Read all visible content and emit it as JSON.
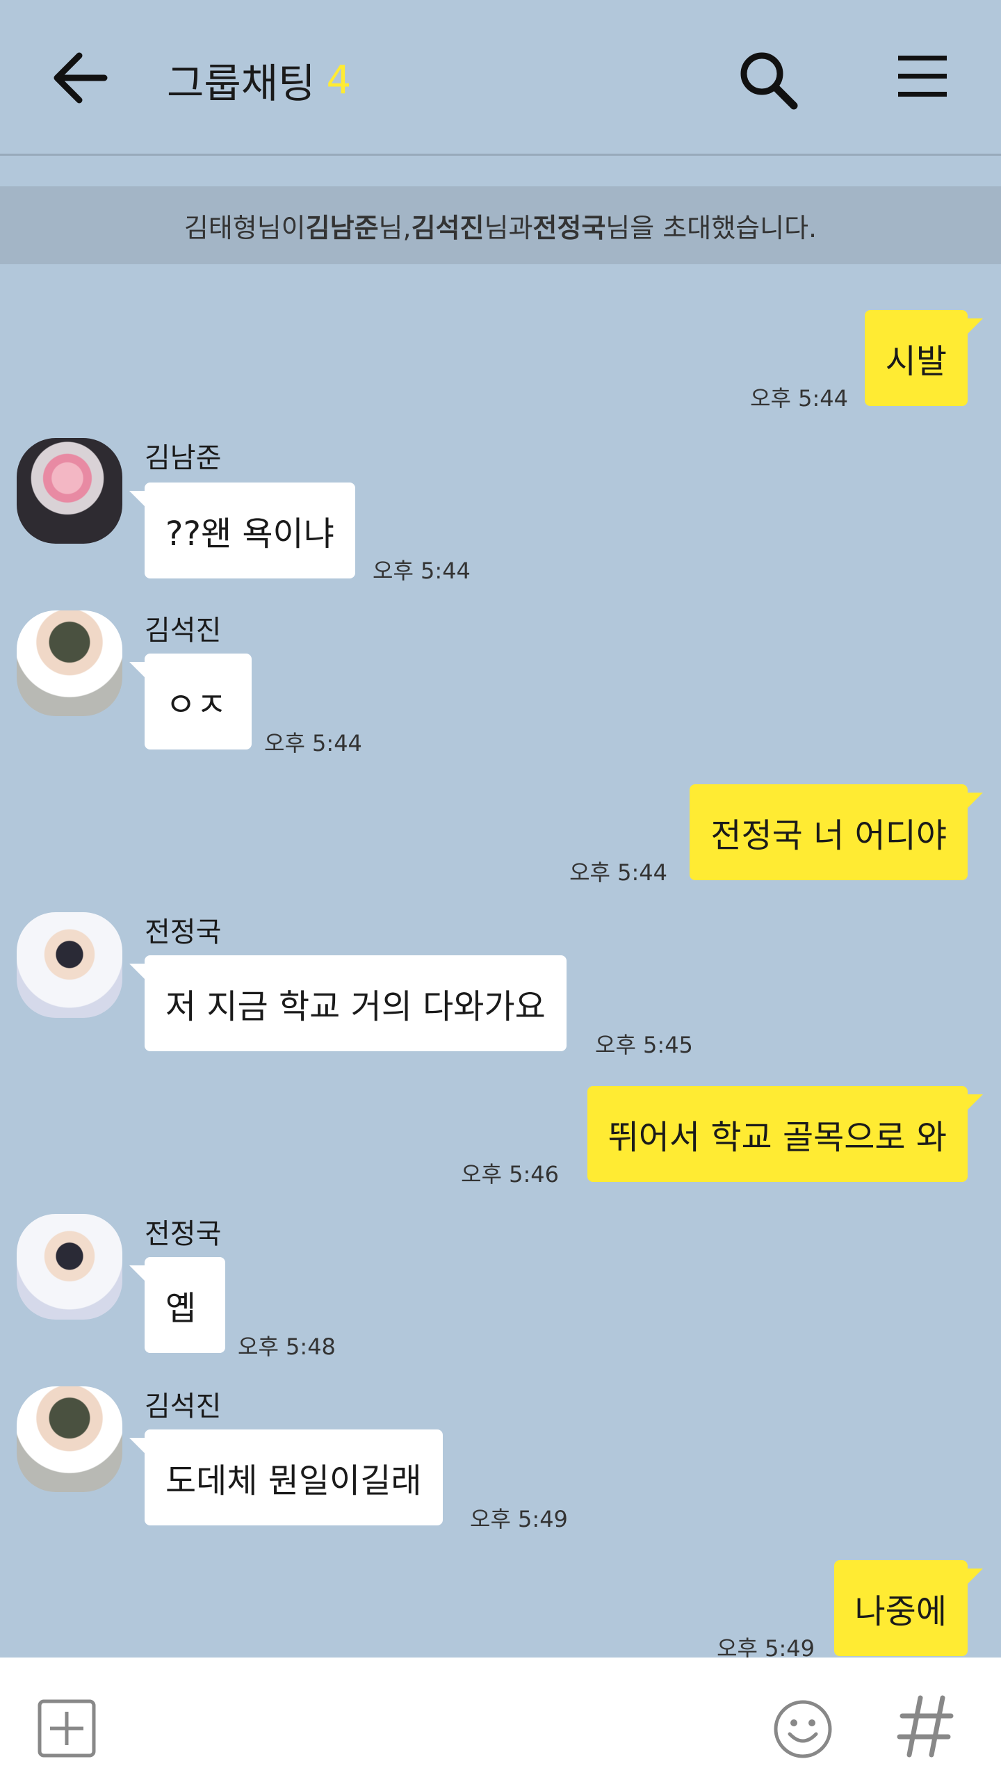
{
  "header": {
    "title": "그룹채팅",
    "member_count": "4",
    "icons": {
      "back": "arrow-left-icon",
      "search": "search-icon",
      "menu": "hamburger-menu-icon"
    }
  },
  "notice": {
    "inviter": "김태형님이 ",
    "invitee1": "김남준",
    "sep1": "님, ",
    "invitee2": "김석진",
    "sep2": "님과 ",
    "invitee3": "전정국",
    "tail": "님을 초대했습니다."
  },
  "messages": [
    {
      "side": "out",
      "text": "시발",
      "time": "오후 5:44"
    },
    {
      "side": "in",
      "sender": "김남준",
      "text": "??왠 욕이냐",
      "time": "오후 5:44"
    },
    {
      "side": "in",
      "sender": "김석진",
      "text": "ㅇㅈ",
      "time": "오후 5:44"
    },
    {
      "side": "out",
      "text": "전정국 너 어디야",
      "time": "오후 5:44"
    },
    {
      "side": "in",
      "sender": "전정국",
      "text": "저 지금 학교 거의 다와가요",
      "time": "오후 5:45"
    },
    {
      "side": "out",
      "text": "뛰어서 학교 골목으로 와",
      "time": "오후 5:46"
    },
    {
      "side": "in",
      "sender": "전정국",
      "text": "옙",
      "time": "오후 5:48"
    },
    {
      "side": "in",
      "sender": "김석진",
      "text": "도데체 뭔일이길래",
      "time": "오후 5:49"
    },
    {
      "side": "out",
      "text": "나중에",
      "time": "오후 5:49"
    }
  ],
  "composer": {
    "icons": {
      "attach": "plus-square-icon",
      "emoji": "smiley-icon",
      "hashtag": "hashtag-icon"
    }
  },
  "colors": {
    "background": "#b2c7da",
    "outgoing_bubble": "#ffeb33",
    "incoming_bubble": "#ffffff",
    "member_count": "#ffeb33"
  }
}
